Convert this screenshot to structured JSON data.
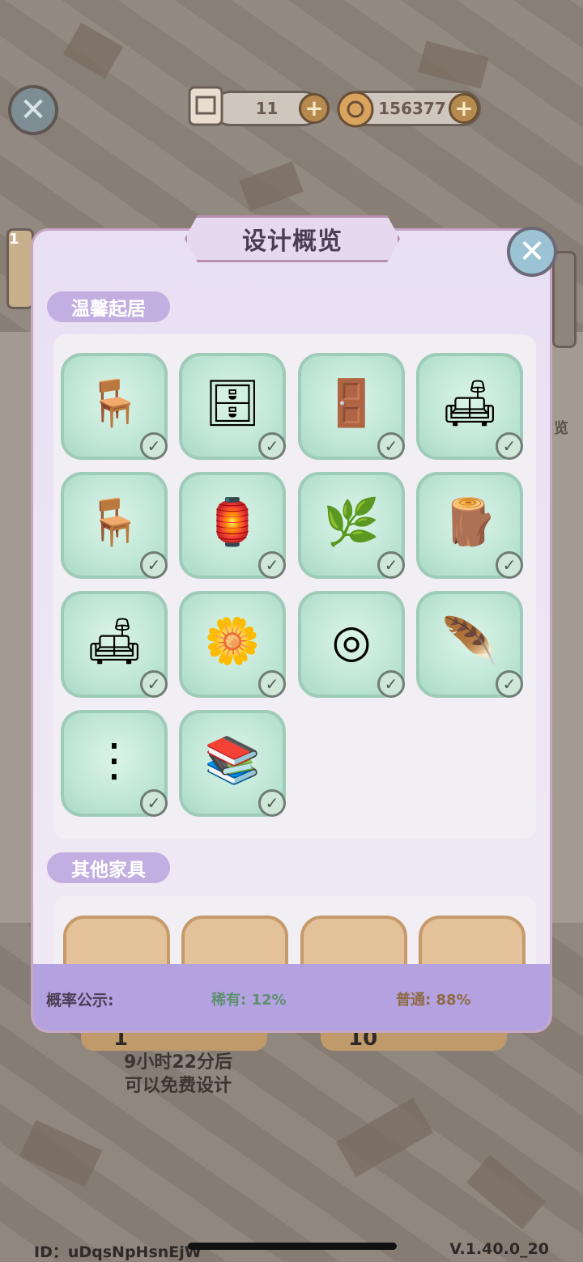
{
  "header": {
    "scroll_count": "11",
    "coin_count": "156377",
    "scroll_icon": "scroll-icon",
    "coin_icon": "coin-icon"
  },
  "modal": {
    "title": "设计概览",
    "sections": [
      {
        "label": "温馨起居"
      },
      {
        "label": "其他家具"
      }
    ],
    "items": [
      {
        "name": "rattan-chair",
        "icon": "🪑"
      },
      {
        "name": "carved-cabinet",
        "icon": "🗄"
      },
      {
        "name": "tall-cupboard",
        "icon": "🚪"
      },
      {
        "name": "rattan-sofa",
        "icon": "🛋"
      },
      {
        "name": "bar-stool",
        "icon": "🪑"
      },
      {
        "name": "lantern-stand",
        "icon": "🏮"
      },
      {
        "name": "branch-vase",
        "icon": "🌿"
      },
      {
        "name": "wooden-table",
        "icon": "🪵"
      },
      {
        "name": "pumpkin-lamp",
        "icon": "🛋"
      },
      {
        "name": "flower-bouquet",
        "icon": "🌼"
      },
      {
        "name": "round-rug",
        "icon": "◎"
      },
      {
        "name": "macrame-hanging",
        "icon": "🪶"
      },
      {
        "name": "bead-string",
        "icon": "⋮"
      },
      {
        "name": "leaf-shelf",
        "icon": "📚"
      }
    ],
    "probability": {
      "label": "概率公示:",
      "rare": "稀有: 12%",
      "common": "普通: 88%"
    }
  },
  "background": {
    "free_text_line1": "9小时22分后",
    "free_text_line2": "可以免费设计",
    "btn_one_label": "1",
    "btn_ten_label": "10",
    "side_text": "览",
    "side_num": "1"
  },
  "footer": {
    "id_text": "ID：uDqsNpHsnEjW",
    "version": "V.1.40.0_20"
  }
}
